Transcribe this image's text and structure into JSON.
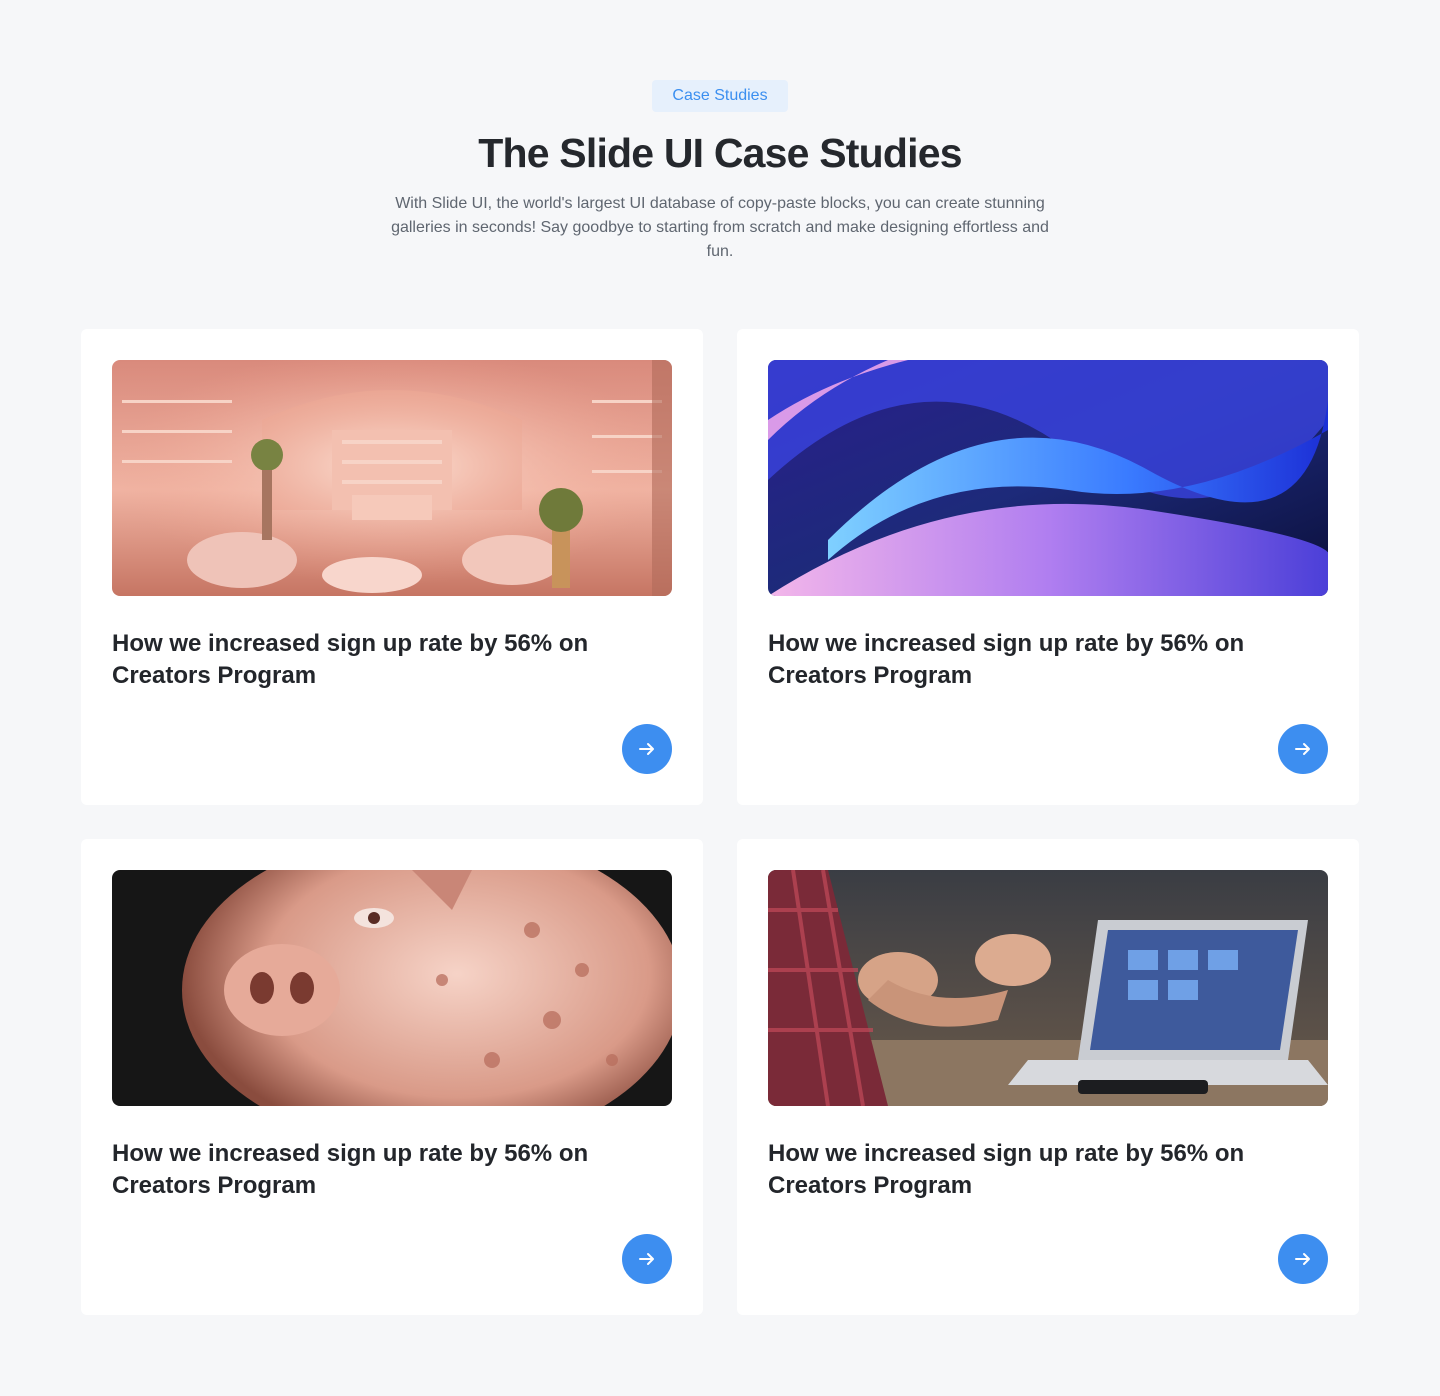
{
  "section": {
    "badge": "Case Studies",
    "title": "The Slide UI Case Studies",
    "subtitle": "With Slide UI, the world's largest UI database of copy-paste blocks, you can create stunning galleries in seconds! Say goodbye to starting from scratch and make designing effortless and fun."
  },
  "cards": [
    {
      "title": "How we increased sign up rate by 56% on Creators Program",
      "image": "pink-boutique-interior",
      "icon": "arrow-right-icon"
    },
    {
      "title": "How we increased sign up rate by 56% on Creators Program",
      "image": "abstract-blue-waves",
      "icon": "arrow-right-icon"
    },
    {
      "title": "How we increased sign up rate by 56% on Creators Program",
      "image": "glass-piggy-bank",
      "icon": "arrow-right-icon"
    },
    {
      "title": "How we increased sign up rate by 56% on Creators Program",
      "image": "hands-laptop-meeting",
      "icon": "arrow-right-icon"
    }
  ],
  "colors": {
    "background": "#f6f7f9",
    "accent": "#3d8ef0",
    "badge_bg": "#e6f0fc",
    "badge_text": "#3b8ff0"
  }
}
